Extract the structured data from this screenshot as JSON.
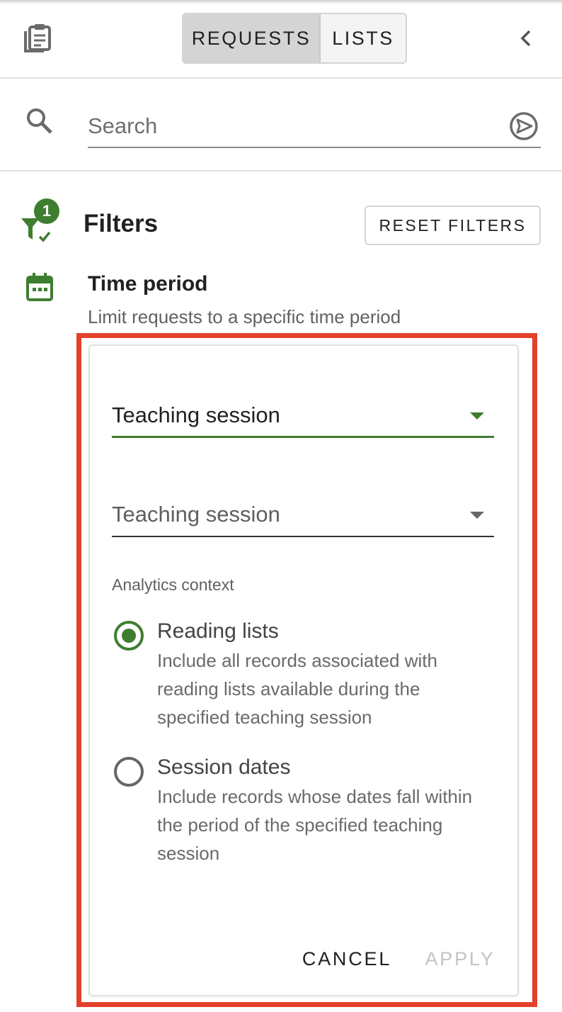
{
  "header": {
    "tabs": [
      {
        "label": "REQUESTS",
        "active": true
      },
      {
        "label": "LISTS",
        "active": false
      }
    ],
    "icons": {
      "left": "clipboard-icon",
      "right": "chevron-left-icon"
    }
  },
  "search": {
    "placeholder": "Search",
    "value": ""
  },
  "filters": {
    "title": "Filters",
    "active_count": "1",
    "reset_label": "RESET FILTERS"
  },
  "time_period": {
    "title": "Time period",
    "subtitle": "Limit requests to a specific time period",
    "select_1": "Teaching session",
    "select_2": "Teaching session",
    "context_label": "Analytics context",
    "options": [
      {
        "title": "Reading lists",
        "description": "Include all records associated with reading lists available during the specified teaching session",
        "selected": true
      },
      {
        "title": "Session dates",
        "description": "Include records whose dates fall within the period of the specified teaching session",
        "selected": false
      }
    ],
    "cancel_label": "CANCEL",
    "apply_label": "APPLY"
  },
  "colors": {
    "accent_green": "#3f7e30",
    "highlight_red": "#e2412c"
  }
}
